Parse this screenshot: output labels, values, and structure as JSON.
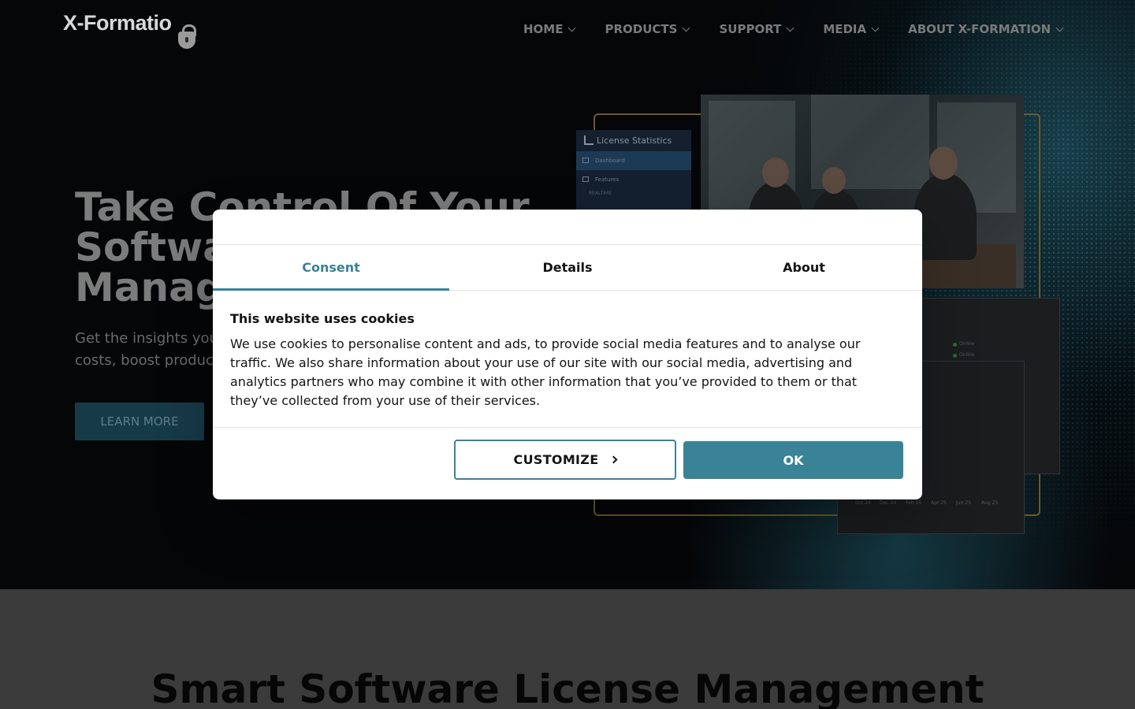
{
  "header": {
    "logo_text": "X-Formatio",
    "nav": [
      {
        "label": "HOME"
      },
      {
        "label": "PRODUCTS"
      },
      {
        "label": "SUPPORT"
      },
      {
        "label": "MEDIA"
      },
      {
        "label": "ABOUT X-FORMATION"
      }
    ]
  },
  "hero": {
    "title_line1": "Take Control Of Your",
    "title_line2": "Softwa",
    "title_line3": "Manage",
    "subtitle_line1": "Get the insights you",
    "subtitle_line2": "costs, boost product",
    "cta_label": "LEARN MORE",
    "collage": {
      "license_title": "License Statistics",
      "menu": [
        "Dashboard",
        "Features"
      ],
      "realtime": "REALTIME",
      "status": [
        "Online",
        "Online"
      ],
      "dates": [
        "Oct 24",
        "Dec 24",
        "Feb 25",
        "Apr 25",
        "Jun 25",
        "Aug 25"
      ]
    }
  },
  "section": {
    "title": "Smart Software License Management"
  },
  "cookie_dialog": {
    "tabs": [
      {
        "label": "Consent",
        "active": true
      },
      {
        "label": "Details",
        "active": false
      },
      {
        "label": "About",
        "active": false
      }
    ],
    "heading": "This website uses cookies",
    "body": "We use cookies to personalise content and ads, to provide social media features and to analyse our traffic. We also share information about your use of our site with our social media, advertising and analytics partners who may combine it with other information that you’ve provided to them or that they’ve collected from your use of their services.",
    "customize_label": "CUSTOMIZE",
    "ok_label": "OK"
  },
  "colors": {
    "accent": "#3a8397",
    "hero_bg": "#050608",
    "dialog_bg": "#ffffff"
  }
}
